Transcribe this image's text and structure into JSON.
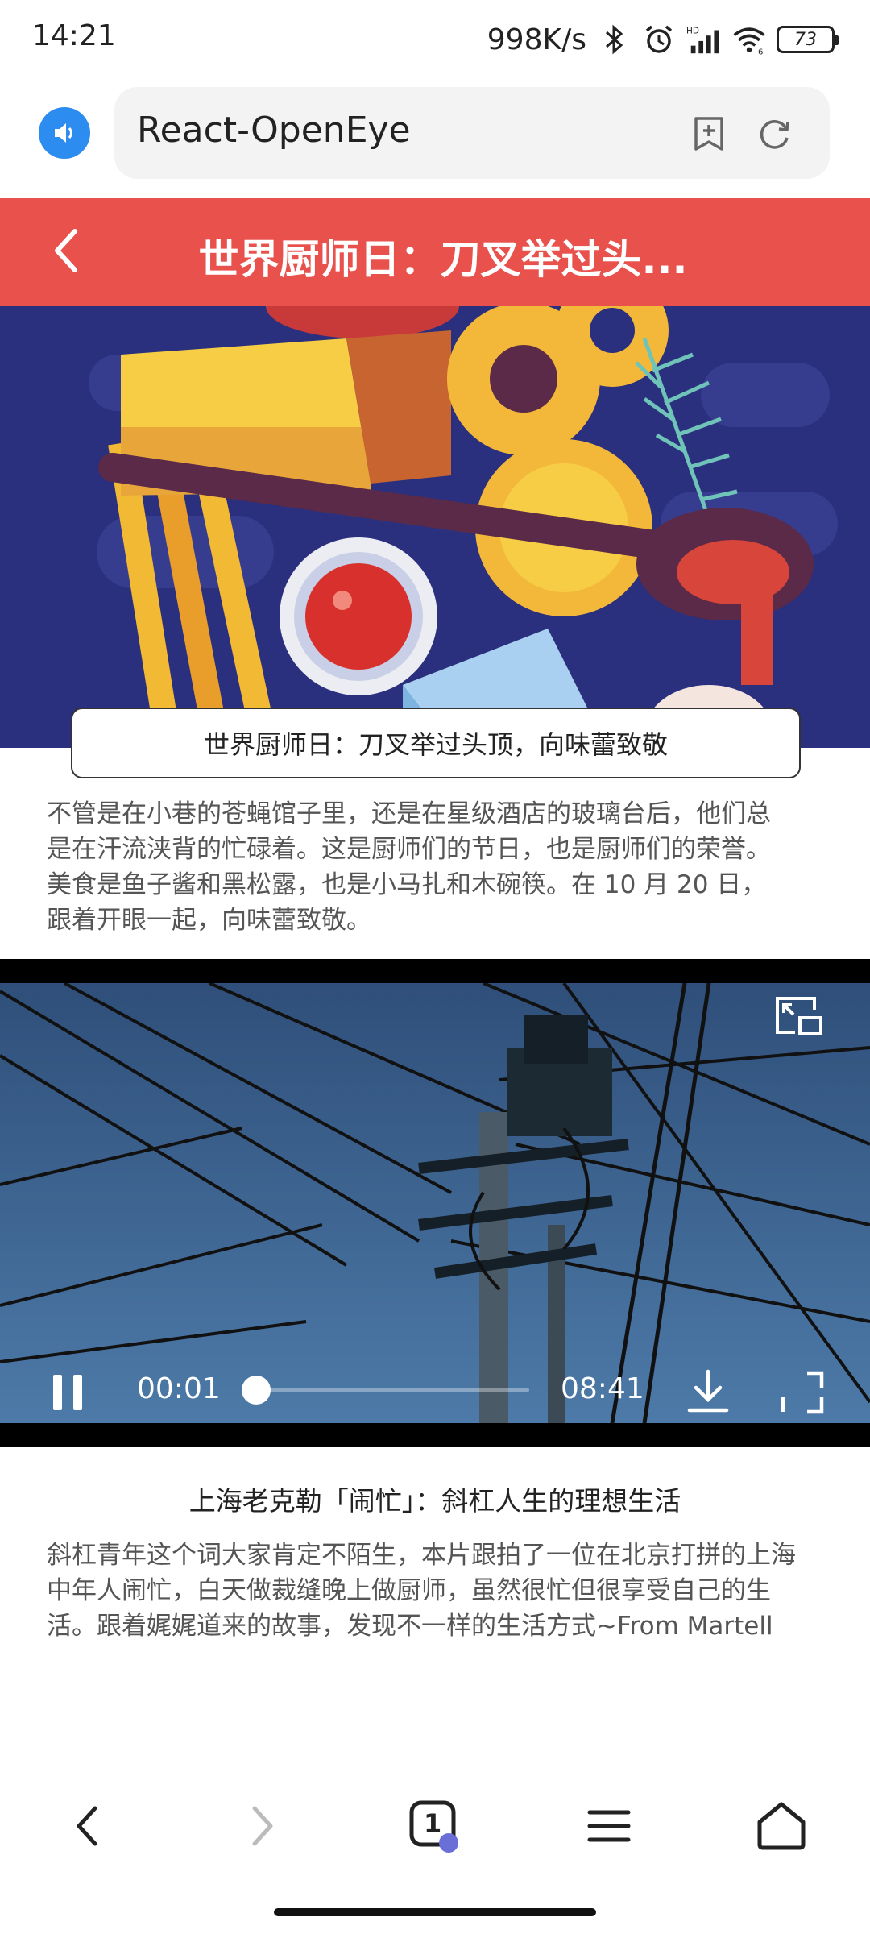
{
  "status_bar": {
    "time": "14:21",
    "network_speed": "998K/s",
    "battery": "73",
    "icons": [
      "bluetooth-icon",
      "alarm-icon",
      "hd-signal-icon",
      "wifi-icon",
      "battery-icon"
    ]
  },
  "browser": {
    "url_title": "React-OpenEye",
    "icons": [
      "speaker-icon",
      "bookmark-add-icon",
      "refresh-icon"
    ]
  },
  "page_header": {
    "title": "世界厨师日：刀叉举过头..."
  },
  "article": {
    "caption": "世界厨师日：刀叉举过头顶，向味蕾致敬",
    "description_lines": [
      "不管是在小巷的苍蝇馆子里，还是在星级酒店的玻璃台后，他们总",
      "是在汗流浃背的忙碌着。这是厨师们的节日，也是厨师们的荣誉。",
      "美食是鱼子酱和黑松露，也是小马扎和木碗筷。在 10 月 20 日，",
      "跟着开眼一起，向味蕾致敬。"
    ]
  },
  "video": {
    "current_time": "00:01",
    "duration": "08:41",
    "progress": 0.002,
    "title": "上海老克勒「闹忙」：斜杠人生的理想生活",
    "description_lines": [
      "斜杠青年这个词大家肯定不陌生，本片跟拍了一位在北京打拼的上海",
      "中年人闹忙，白天做裁缝晚上做厨师，虽然很忙但很享受自己的生",
      "活。跟着娓娓道来的故事，发现不一样的生活方式~From Martell"
    ]
  },
  "bottom_nav": {
    "tab_count": "1",
    "icons": [
      "back-icon",
      "forward-icon",
      "tabs-icon",
      "menu-icon",
      "home-icon"
    ]
  },
  "colors": {
    "accent_red": "#e8514c",
    "speaker_blue": "#2d8cf0",
    "cover_bg": "#2a2f7e"
  }
}
